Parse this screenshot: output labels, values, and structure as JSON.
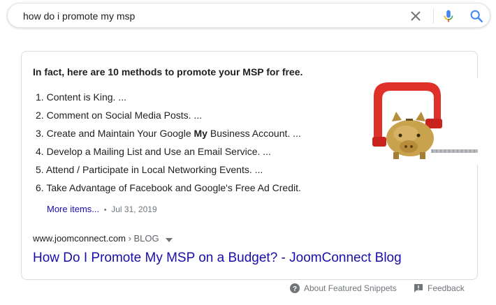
{
  "search": {
    "query": "how do i promote my msp",
    "icons": [
      "close-icon",
      "mic-icon",
      "search-icon"
    ]
  },
  "snippet": {
    "heading": "In fact, here are 10 methods to promote your MSP for free.",
    "items": [
      {
        "num": "1.",
        "text": "Content is King. ..."
      },
      {
        "num": "2.",
        "text": "Comment on Social Media Posts. ..."
      },
      {
        "num": "3.",
        "text_before": "Create and Maintain Your Google ",
        "text_bold": "My",
        "text_after": " Business Account. ..."
      },
      {
        "num": "4.",
        "text": "Develop a Mailing List and Use an Email Service. ..."
      },
      {
        "num": "5.",
        "text": "Attend / Participate in Local Networking Events. ..."
      },
      {
        "num": "6.",
        "text": "Take Advantage of Facebook and Google's Free Ad Credit."
      }
    ],
    "more_label": "More items...",
    "separator": "•",
    "date": "Jul 31, 2019",
    "image_alt": "piggy bank in red clamp"
  },
  "result": {
    "domain": "www.joomconnect.com",
    "breadcrumb": " › BLOG",
    "title": "How Do I Promote My MSP on a Budget? - JoomConnect Blog"
  },
  "footer": {
    "about_label": "About Featured Snippets",
    "feedback_label": "Feedback"
  },
  "colors": {
    "link": "#1a0dab",
    "text": "#202124",
    "muted": "#70757a",
    "mic_blue": "#4285f4",
    "mic_red": "#ea4335",
    "clamp_red": "#e0302a",
    "piggy_gold": "#c9a24e"
  }
}
